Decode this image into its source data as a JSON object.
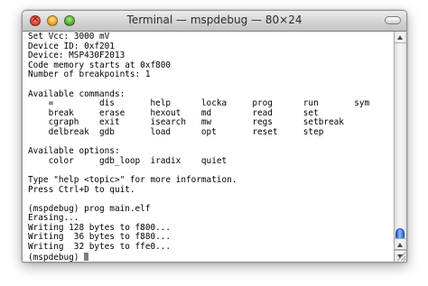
{
  "window": {
    "title": "Terminal — mspdebug — 80×24"
  },
  "terminal": {
    "lines": [
      "Set Vcc: 3000 mV",
      "Device ID: 0xf201",
      "Device: MSP430F2013",
      "Code memory starts at 0xf800",
      "Number of breakpoints: 1",
      "",
      "Available commands:",
      "    =         dis       help      locka     prog      run       sym",
      "    break     erase     hexout    md        read      set",
      "    cgraph    exit      isearch   mw        regs      setbreak",
      "    delbreak  gdb       load      opt       reset     step",
      "",
      "Available options:",
      "    color     gdb_loop  iradix    quiet",
      "",
      "Type \"help <topic>\" for more information.",
      "Press Ctrl+D to quit.",
      "",
      "(mspdebug) prog main.elf",
      "Erasing...",
      "Writing 128 bytes to f800...",
      "Writing  36 bytes to f880...",
      "Writing  32 bytes to ffe0...",
      "(mspdebug) "
    ]
  },
  "icons": {
    "close": "close-button-icon",
    "minimize": "minimize-button-icon",
    "zoom": "zoom-button-icon",
    "toolbar_toggle": "toolbar-toggle-pill-icon",
    "resize": "resize-grip-icon"
  },
  "colors": {
    "close": "#e0443a",
    "minimize": "#e7a826",
    "zoom": "#5cae35",
    "scroll_thumb": "#2f6ad6",
    "text": "#000000",
    "background": "#ffffff"
  }
}
